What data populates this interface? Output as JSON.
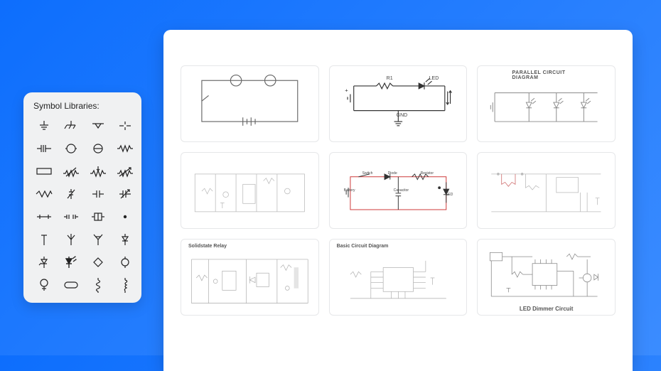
{
  "symbol_panel": {
    "title": "Symbol Libraries:",
    "symbols": [
      "ground-icon",
      "chassis-ground-icon",
      "triangle-ground-icon",
      "node-icon",
      "capacitor-icon",
      "circle-icon",
      "circle-slash-icon",
      "resistor-icon",
      "rectangle-icon",
      "variable-resistor-icon",
      "potentiometer-icon",
      "variable-resistor2-icon",
      "zigzag-icon",
      "diode-small-icon",
      "capacitor2-icon",
      "variable-cap-icon",
      "fuse-icon",
      "fuse2-icon",
      "component-icon",
      "dot-icon",
      "antenna1-icon",
      "antenna2-icon",
      "antenna3-icon",
      "diode2-icon",
      "diode-arrow-icon",
      "led-icon",
      "diamond-icon",
      "loop-icon",
      "meter-icon",
      "rounded-rect-icon",
      "coil1-icon",
      "coil2-icon"
    ]
  },
  "templates": [
    {
      "id": "simple-loop",
      "title": ""
    },
    {
      "id": "led-circuit",
      "title": "",
      "labels": {
        "r1": "R1",
        "led": "LED",
        "gnd": "GND"
      }
    },
    {
      "id": "parallel-circuit",
      "title": "PARALLEL  CIRCUIT DIAGRAM"
    },
    {
      "id": "complex1",
      "title": ""
    },
    {
      "id": "basic-components",
      "title": "",
      "labels": {
        "switch": "Switch",
        "diode": "Diode",
        "resistor": "Resistor",
        "battery": "Battery",
        "capacitor": "Capacitor",
        "led2": "LED"
      }
    },
    {
      "id": "complex2",
      "title": ""
    },
    {
      "id": "solidstate-relay",
      "title": "Solidstate Relay"
    },
    {
      "id": "basic-circuit",
      "title": "Basic Circuit Diagram"
    },
    {
      "id": "led-dimmer",
      "title": "LED Dimmer Circuit"
    }
  ]
}
